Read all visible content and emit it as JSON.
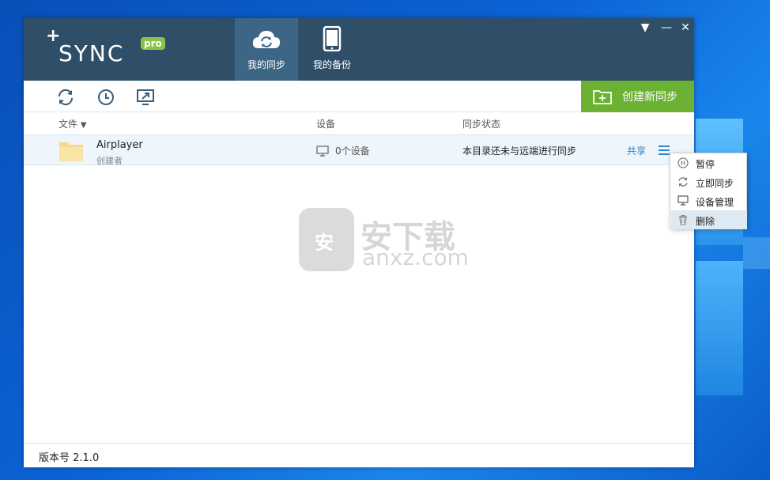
{
  "app": {
    "logo_plus": "+",
    "logo_word": "SYNC",
    "logo_badge": "pro",
    "nav": [
      {
        "label": "我的同步",
        "icon": "cloud-sync-icon",
        "active": true
      },
      {
        "label": "我的备份",
        "icon": "phone-icon",
        "active": false
      }
    ],
    "window_controls": {
      "menu": "▼",
      "minimize": "—",
      "close": "✕"
    }
  },
  "toolbar": {
    "create_label": "创建新同步",
    "tools": [
      "sync-icon",
      "clock-icon",
      "screen-cast-icon"
    ]
  },
  "table": {
    "columns": {
      "file": "文件",
      "device": "设备",
      "status": "同步状态"
    },
    "sort_indicator": "▼",
    "rows": [
      {
        "name": "Airplayer",
        "creator": "创建者",
        "devices": "0个设备",
        "status": "本目录还未与远端进行同步",
        "share": "共享"
      }
    ]
  },
  "context_menu": {
    "items": [
      {
        "label": "暂停",
        "icon": "pause-icon"
      },
      {
        "label": "立即同步",
        "icon": "sync-icon"
      },
      {
        "label": "设备管理",
        "icon": "monitor-icon"
      },
      {
        "label": "删除",
        "icon": "trash-icon",
        "highlighted": true
      }
    ]
  },
  "watermark": {
    "cn": "安下载",
    "en": "anxz.com",
    "badge": "安"
  },
  "footer": {
    "version": "版本号 2.1.0"
  },
  "colors": {
    "titlebar": "#2f4f68",
    "active_tab": "#3d6584",
    "create": "#6bb133",
    "accent": "#2f86c8"
  }
}
